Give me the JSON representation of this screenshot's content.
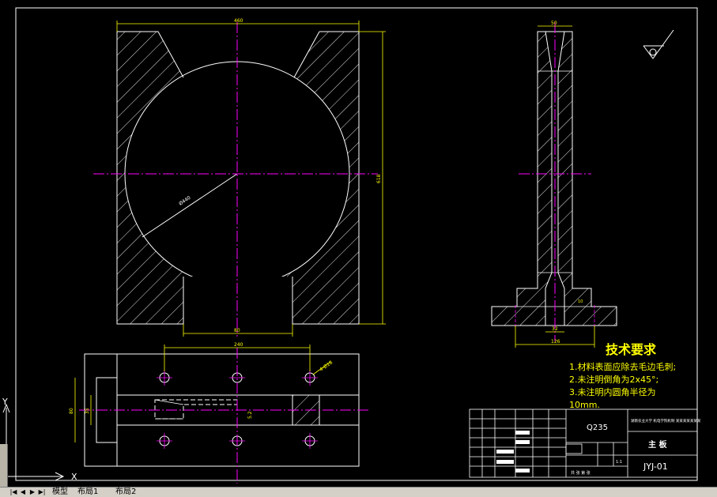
{
  "colors": {
    "background": "#000000",
    "outline": "#ffffff",
    "centerline": "#ff00ff",
    "dimension": "#ffff00",
    "hatch": "#ffffff",
    "text_yellow": "#ffff00"
  },
  "dimensions": {
    "top_width": "460",
    "height": "618",
    "diameter": "Ø440",
    "bottom_slot": "80",
    "side_top": "50",
    "side_small": "10",
    "side_base_inner": "32",
    "side_base": "126",
    "bottom_span": "240",
    "hole": "4-Ø18",
    "bottom_h1": "80",
    "bottom_h2": "35",
    "bottom_inner": "5.2"
  },
  "tech_req": {
    "title": "技术要求",
    "line1": "1.材料表面应除去毛边毛刺;",
    "line2": "2.未注明倒角为2x45°;",
    "line3": "3.未注明内圆角半径为",
    "line4": "10mm."
  },
  "title_block": {
    "material": "Q235",
    "part_name": "主  板",
    "drawing_no": "JYJ-01",
    "school": "湖南农业大学 机电学院机制 某某某某某某某",
    "scale": "1:1",
    "sheet": "共 张 第 张"
  },
  "ucs": {
    "y_label": "Y",
    "x_label": "X"
  },
  "tabs": {
    "model": "模型",
    "layout1": "布局1",
    "layout2": "布局2"
  }
}
